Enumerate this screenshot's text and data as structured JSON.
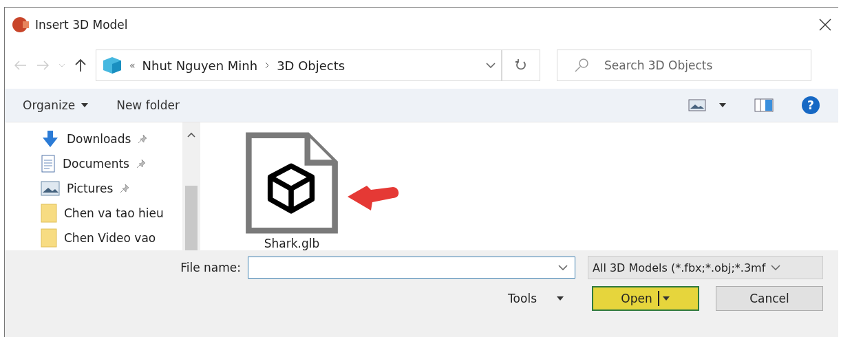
{
  "window": {
    "title": "Insert 3D Model"
  },
  "address": {
    "overflow": "«",
    "crumbs": [
      "Nhut Nguyen Minh",
      "3D Objects"
    ]
  },
  "search": {
    "placeholder": "Search 3D Objects"
  },
  "commands": [
    {
      "label": "Organize",
      "dropdown": true
    },
    {
      "label": "New folder",
      "dropdown": false
    }
  ],
  "sidebar": {
    "items": [
      {
        "label": "Downloads",
        "kind": "downloads",
        "pinned": true
      },
      {
        "label": "Documents",
        "kind": "documents",
        "pinned": true
      },
      {
        "label": "Pictures",
        "kind": "pictures",
        "pinned": true
      },
      {
        "label": "Chen va tao hieu",
        "kind": "folder",
        "pinned": false
      },
      {
        "label": "Chen Video vao",
        "kind": "folder",
        "pinned": false
      }
    ]
  },
  "files": [
    {
      "name": "Shark.glb",
      "highlighted": true
    }
  ],
  "help": {
    "label": "?"
  },
  "file_name": {
    "label": "File name:"
  },
  "file_type": {
    "value": "All 3D Models (*.fbx;*.obj;*.3mf"
  },
  "buttons": [
    {
      "label": "Tools",
      "kind": "menu"
    },
    {
      "label": "Open",
      "kind": "primary"
    },
    {
      "label": "Cancel",
      "kind": "plain"
    }
  ]
}
